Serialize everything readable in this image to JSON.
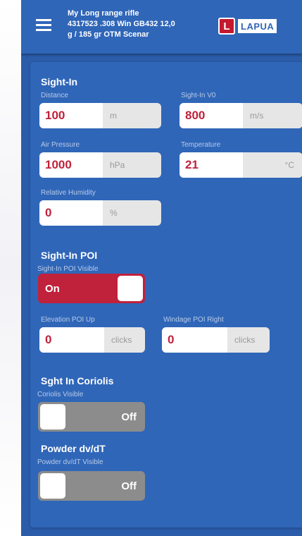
{
  "header": {
    "title_line1": "My Long range rifle",
    "title_line2": "4317523 .308 Win GB432 12,0",
    "title_line3": "g / 185 gr  OTM Scenar",
    "logo_mark": "L",
    "logo_text": "LAPUA"
  },
  "sight_in": {
    "title": "Sight-In",
    "distance": {
      "label": "Distance",
      "value": "100",
      "unit": "m"
    },
    "v0": {
      "label": "Sight-In V0",
      "value": "800",
      "unit": "m/s"
    },
    "air_pressure": {
      "label": "Air Pressure",
      "value": "1000",
      "unit": "hPa"
    },
    "temperature": {
      "label": "Temperature",
      "value": "21",
      "unit": "°C"
    },
    "humidity": {
      "label": "Relative Humidity",
      "value": "0",
      "unit": "%"
    }
  },
  "sight_in_poi": {
    "title": "Sight-In POI",
    "visible_label": "Sight-In POI Visible",
    "visible_state": "On",
    "elevation": {
      "label": "Elevation POI Up",
      "value": "0",
      "unit": "clicks"
    },
    "windage": {
      "label": "Windage POI Right",
      "value": "0",
      "unit": "clicks"
    }
  },
  "coriolis": {
    "title": "Sght In Coriolis",
    "visible_label": "Coriolis Visible",
    "visible_state": "Off"
  },
  "powder": {
    "title": "Powder dv/dT",
    "visible_label": "Powder dv/dT Visible",
    "visible_state": "Off"
  },
  "colors": {
    "primary": "#2f66b8",
    "accent": "#c0213b",
    "toggle_off": "#8c8c8c"
  }
}
